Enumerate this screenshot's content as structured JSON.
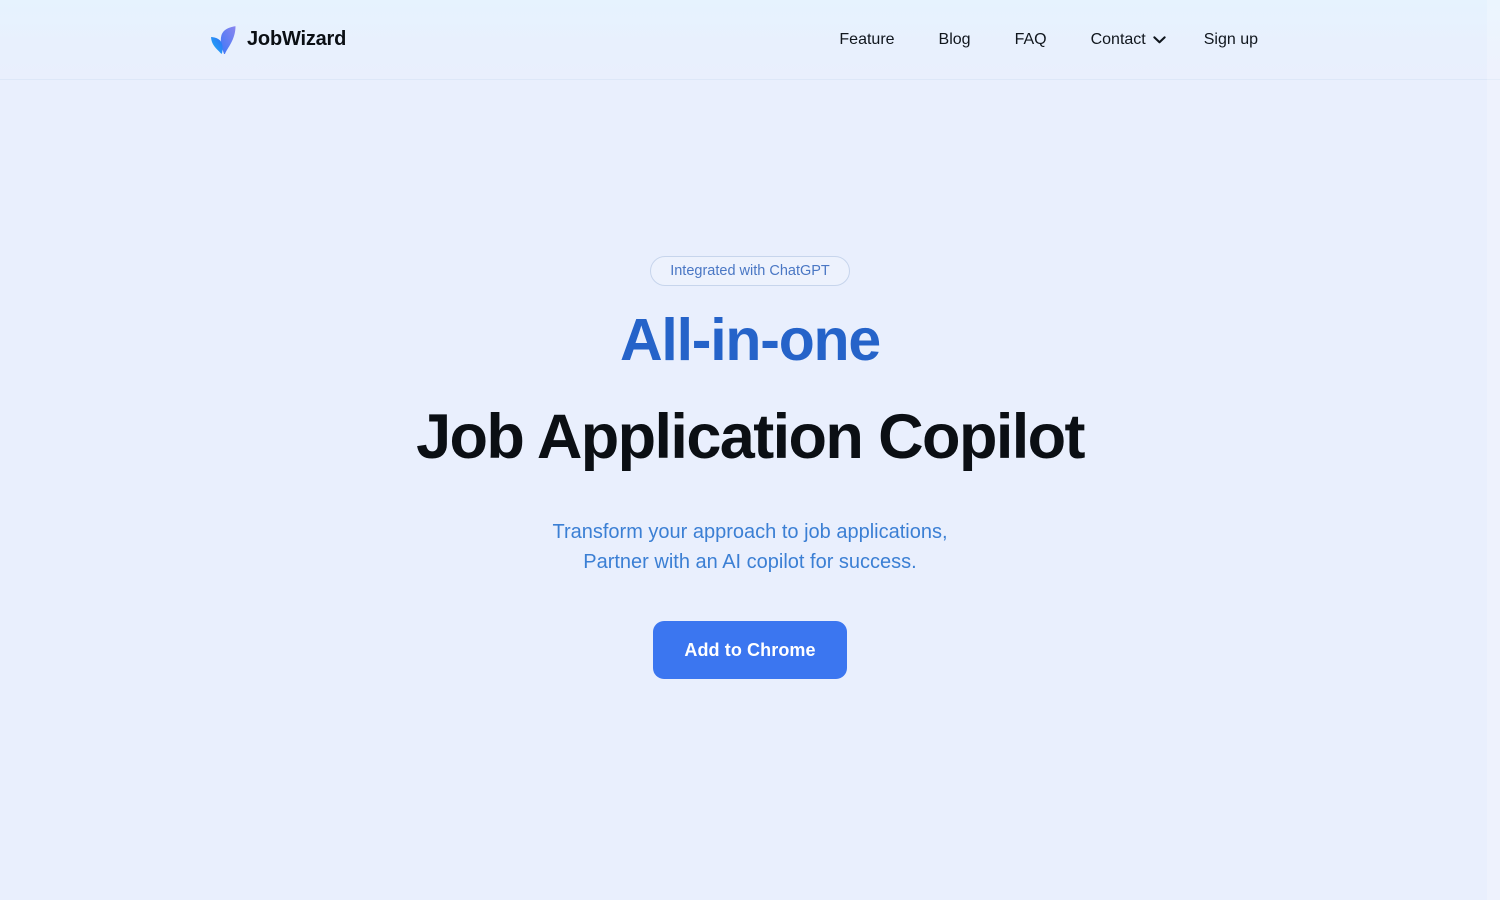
{
  "header": {
    "brand": {
      "name": "JobWizard",
      "logo_icon": "jobwizard-leaf-logo",
      "leaf_left_color_start": "#29a9f5",
      "leaf_left_color_end": "#2b6ef5",
      "leaf_right_color_start": "#4a7cf7",
      "leaf_right_color_end": "#8184f0"
    },
    "nav": [
      {
        "label": "Feature",
        "has_dropdown": false
      },
      {
        "label": "Blog",
        "has_dropdown": false
      },
      {
        "label": "FAQ",
        "has_dropdown": false
      },
      {
        "label": "Contact",
        "has_dropdown": true,
        "caret_icon": "chevron-down-icon"
      },
      {
        "label": "Sign up",
        "has_dropdown": false
      }
    ]
  },
  "hero": {
    "badge": "Integrated with ChatGPT",
    "title_accent": "All-in-one",
    "title_main": "Job Application Copilot",
    "subtitle_line1": "Transform your approach to job applications,",
    "subtitle_line2": "Partner with an AI copilot for success.",
    "cta_label": "Add to Chrome"
  },
  "colors": {
    "page_background": "#e9effd",
    "header_background_top": "#e6f3fe",
    "accent_blue": "#2563c9",
    "cta_blue": "#3b76f0",
    "subtitle_blue": "#3b7fd4",
    "badge_text_blue": "#4a77c4",
    "badge_border": "#c7d5ec",
    "heading_black": "#0b0f14"
  }
}
